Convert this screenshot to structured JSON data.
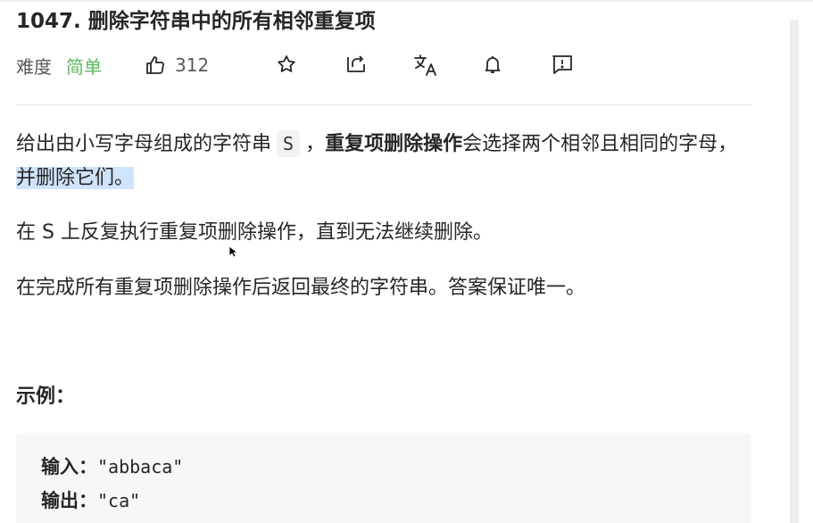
{
  "problem": {
    "title": "1047. 删除字符串中的所有相邻重复项",
    "difficulty_label": "难度",
    "difficulty": "简单",
    "likes": "312"
  },
  "icons": [
    "thumbs-up-icon",
    "star-icon",
    "share-icon",
    "translate-icon",
    "bell-icon",
    "feedback-icon"
  ],
  "colors": {
    "difficulty_easy": "#5cb85c",
    "text": "#262626",
    "selection": "#cfe3fb",
    "code_bg": "#f7f7f8"
  },
  "description": {
    "p1_a": "给出由小写字母组成的字符串",
    "p1_code": "S",
    "p1_b": "，",
    "p1_bold": "重复项删除操作",
    "p1_c": "会选择两个相邻且相同的字母，",
    "p1_selected": "并删除它们。",
    "p2": "在 S 上反复执行重复项删除操作，直到无法继续删除。",
    "p3": "在完成所有重复项删除操作后返回最终的字符串。答案保证唯一。"
  },
  "example": {
    "title": "示例：",
    "input_label": "输入：",
    "input_value": "\"abbaca\"",
    "output_label": "输出：",
    "output_value": "\"ca\""
  }
}
